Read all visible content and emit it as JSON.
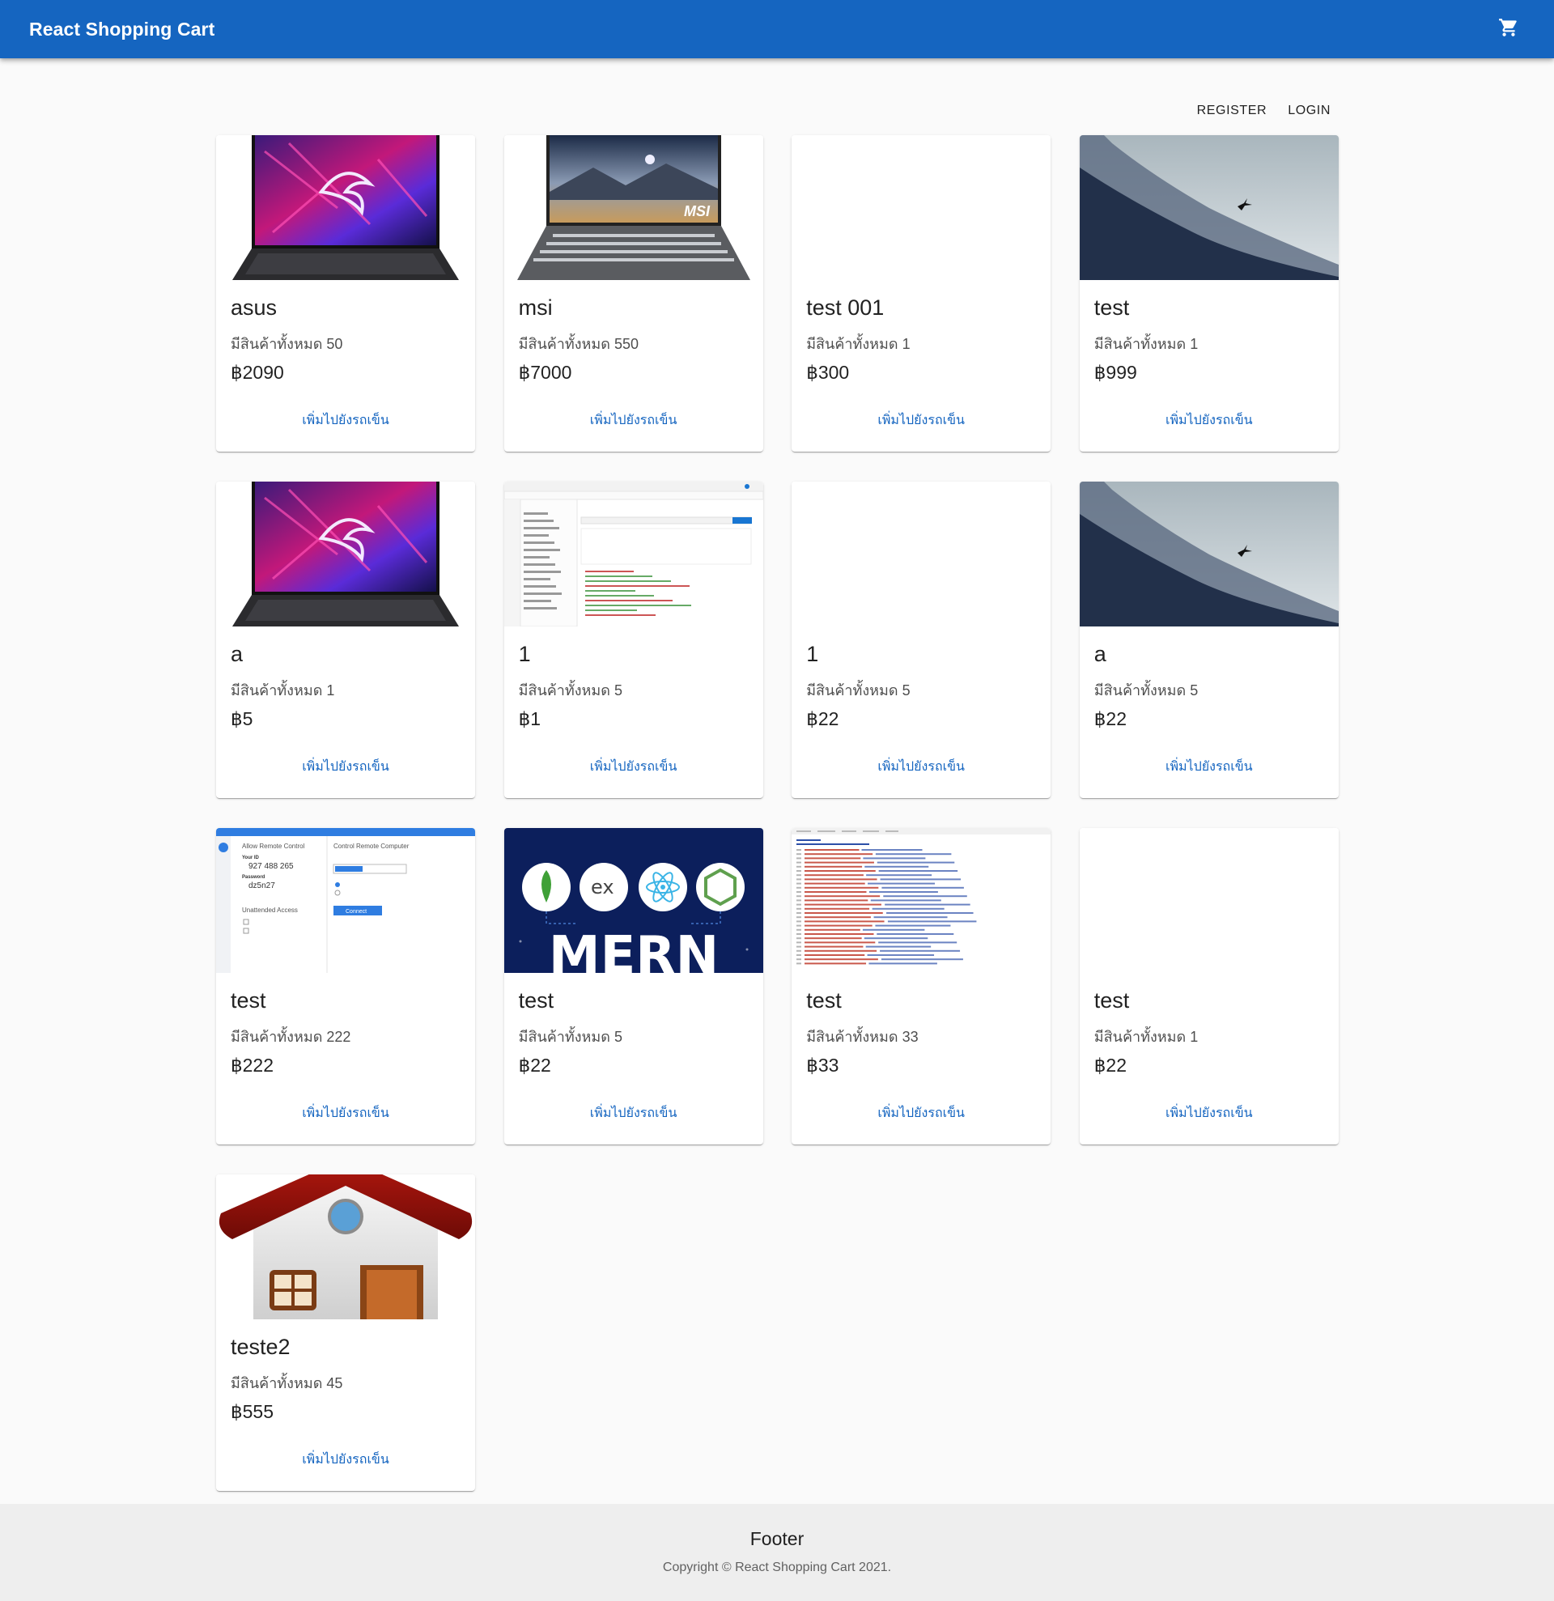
{
  "header": {
    "title": "React Shopping Cart",
    "cart_icon": "shopping-cart-icon"
  },
  "auth": {
    "register": "REGISTER",
    "login": "LOGIN"
  },
  "stock_prefix": "มีสินค้าทั้งหมด",
  "currency": "฿",
  "add_to_cart_label": "เพิ่มไปยังรถเข็น",
  "products": [
    {
      "name": "asus",
      "stock": "50",
      "price": "2090",
      "image": "gaming-laptop"
    },
    {
      "name": "msi",
      "stock": "550",
      "price": "7000",
      "image": "msi-laptop"
    },
    {
      "name": "test 001",
      "stock": "1",
      "price": "300",
      "image": "blank"
    },
    {
      "name": "test",
      "stock": "1",
      "price": "999",
      "image": "misty-mountain"
    },
    {
      "name": "a",
      "stock": "1",
      "price": "5",
      "image": "gaming-laptop"
    },
    {
      "name": "1",
      "stock": "5",
      "price": "1",
      "image": "api-screenshot"
    },
    {
      "name": "1",
      "stock": "5",
      "price": "22",
      "image": "blank"
    },
    {
      "name": "a",
      "stock": "5",
      "price": "22",
      "image": "misty-mountain"
    },
    {
      "name": "test",
      "stock": "222",
      "price": "222",
      "image": "remote-access-screenshot"
    },
    {
      "name": "test",
      "stock": "5",
      "price": "22",
      "image": "mern-banner"
    },
    {
      "name": "test",
      "stock": "33",
      "price": "33",
      "image": "code-screenshot"
    },
    {
      "name": "test",
      "stock": "1",
      "price": "22",
      "image": "blank"
    },
    {
      "name": "teste2",
      "stock": "45",
      "price": "555",
      "image": "house-icon"
    }
  ],
  "image_text": {
    "mern_banner": "MERN",
    "mern_ex": "ex",
    "remote_allow": "Allow Remote Control",
    "remote_control": "Control Remote Computer",
    "remote_your_id": "Your ID",
    "remote_id": "927 488 265",
    "remote_password_label": "Password",
    "remote_password": "dz5n27",
    "remote_unattended": "Unattended Access",
    "remote_connect": "Connect"
  },
  "footer": {
    "title": "Footer",
    "copyright": "Copyright © React Shopping Cart 2021."
  },
  "colors": {
    "appbar": "#1565c0",
    "accent": "#1565c0",
    "footer_bg": "#eeeeee"
  }
}
